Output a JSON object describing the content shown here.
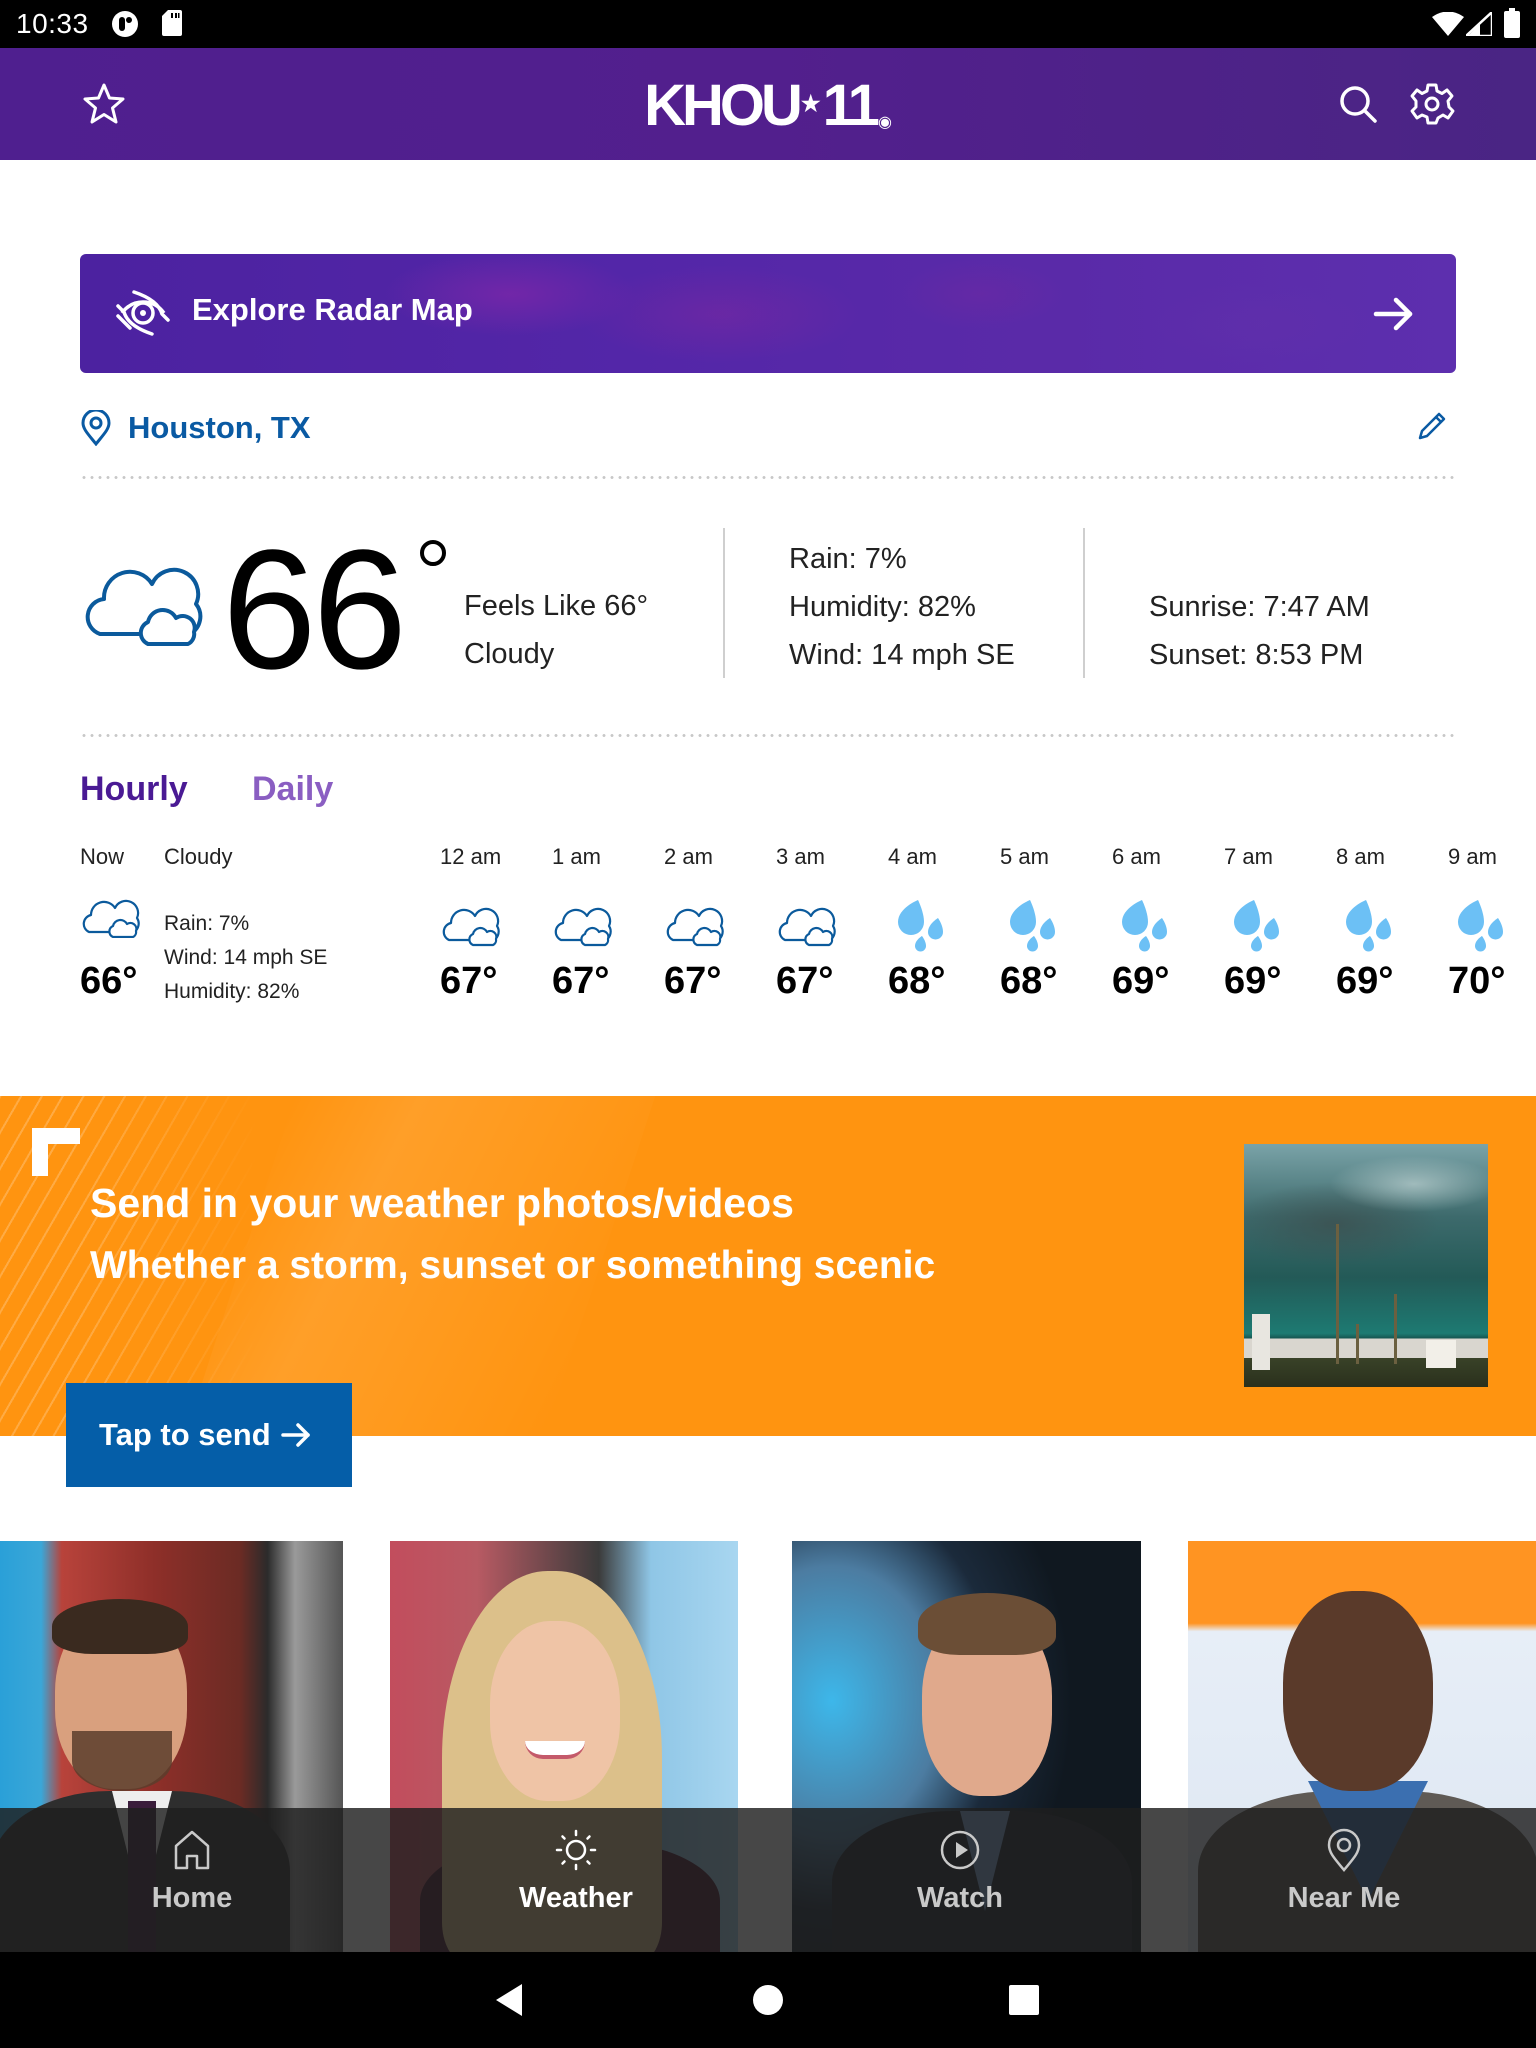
{
  "status_bar": {
    "time": "10:33",
    "left_icons": [
      "app-notification-icon",
      "sd-card-icon"
    ],
    "right_icons": [
      "wifi-icon",
      "cell-signal-icon",
      "battery-icon"
    ]
  },
  "header": {
    "logo_text": "KHOU",
    "logo_number": "11",
    "left_icon": "star-icon",
    "right_icons": [
      "search-icon",
      "gear-icon"
    ]
  },
  "radar_banner": {
    "label": "Explore Radar Map",
    "icon": "radar-icon",
    "arrow": "arrow-right-icon"
  },
  "location": {
    "name": "Houston, TX",
    "icon": "map-pin-icon",
    "edit_icon": "pencil-icon"
  },
  "current": {
    "temperature": "66",
    "condition_icon": "cloudy-icon",
    "feels_like": "Feels Like 66°",
    "condition": "Cloudy",
    "rain": "Rain: 7%",
    "humidity": "Humidity: 82%",
    "wind": "Wind: 14 mph SE",
    "sunrise": "Sunrise: 7:47 AM",
    "sunset": "Sunset: 8:53 PM"
  },
  "forecast_tabs": [
    {
      "label": "Hourly",
      "active": true
    },
    {
      "label": "Daily",
      "active": false
    }
  ],
  "now": {
    "label": "Now",
    "condition": "Cloudy",
    "temp": "66°",
    "rain": "Rain: 7%",
    "wind": "Wind: 14 mph SE",
    "humidity": "Humidity: 82%"
  },
  "hourly": [
    {
      "time": "12 am",
      "icon": "cloudy",
      "temp": "67°"
    },
    {
      "time": "1 am",
      "icon": "cloudy",
      "temp": "67°"
    },
    {
      "time": "2 am",
      "icon": "cloudy",
      "temp": "67°"
    },
    {
      "time": "3 am",
      "icon": "cloudy",
      "temp": "67°"
    },
    {
      "time": "4 am",
      "icon": "rain",
      "temp": "68°"
    },
    {
      "time": "5 am",
      "icon": "rain",
      "temp": "68°"
    },
    {
      "time": "6 am",
      "icon": "rain",
      "temp": "69°"
    },
    {
      "time": "7 am",
      "icon": "rain",
      "temp": "69°"
    },
    {
      "time": "8 am",
      "icon": "rain",
      "temp": "69°"
    },
    {
      "time": "9 am",
      "icon": "rain",
      "temp": "70°"
    }
  ],
  "promo": {
    "title": "Send in your weather photos/videos",
    "subtitle": "Whether a storm, sunset or something scenic",
    "button_label": "Tap to send",
    "photo": "storm-clouds-photo"
  },
  "anchors": [
    "meteorologist-photo-1",
    "meteorologist-photo-2",
    "meteorologist-photo-3",
    "meteorologist-photo-4"
  ],
  "bottom_nav": [
    {
      "label": "Home",
      "icon": "home-icon",
      "active": false
    },
    {
      "label": "Weather",
      "icon": "sun-icon",
      "active": true
    },
    {
      "label": "Watch",
      "icon": "play-icon",
      "active": false
    },
    {
      "label": "Near Me",
      "icon": "map-pin-icon",
      "active": false
    }
  ],
  "colors": {
    "brand_purple": "#4f1f8f",
    "tab_active": "#4a1a94",
    "tab_inactive": "#8a5ec2",
    "location_blue": "#0a5aa3",
    "icon_blue": "#0b5a9c",
    "rain_blue": "#6cc0f5",
    "promo_orange": "#ff9410",
    "button_blue": "#055ea8"
  }
}
